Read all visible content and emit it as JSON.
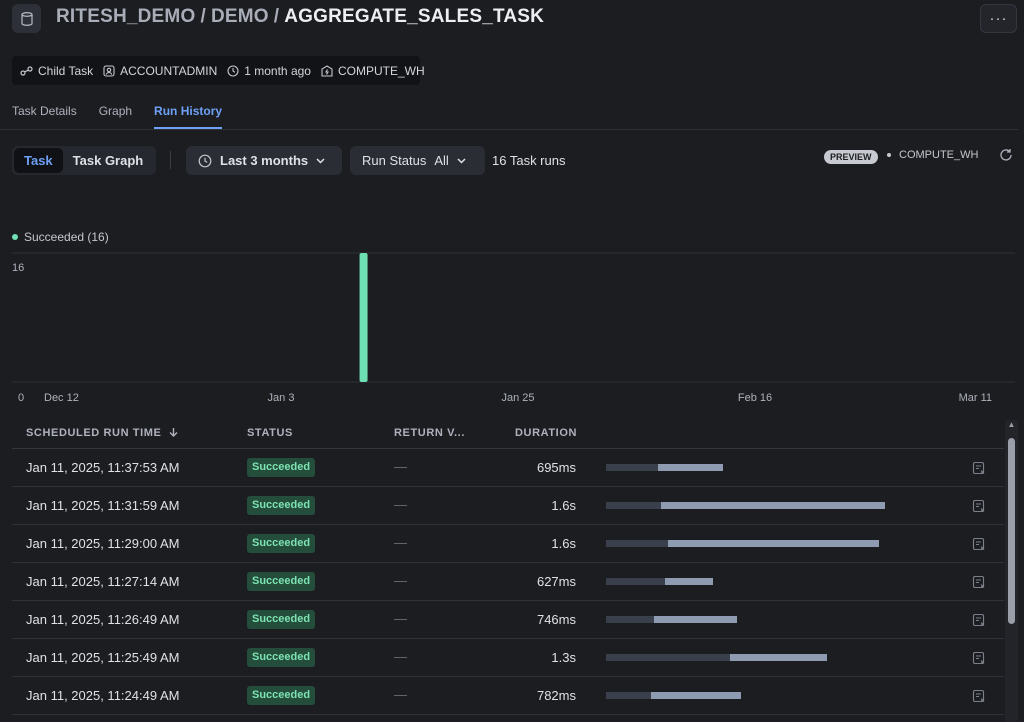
{
  "header": {
    "crumb1": "RITESH_DEMO",
    "crumb2": "DEMO",
    "separator": "/",
    "title": "AGGREGATE_SALES_TASK",
    "more_label": "···"
  },
  "meta": {
    "task_type": "Child Task",
    "role": "ACCOUNTADMIN",
    "age": "1 month ago",
    "warehouse": "COMPUTE_WH"
  },
  "tabs": [
    {
      "label": "Task Details",
      "active": false
    },
    {
      "label": "Graph",
      "active": false
    },
    {
      "label": "Run History",
      "active": true
    }
  ],
  "toolbar": {
    "view_task": "Task",
    "view_graph": "Task Graph",
    "range": "Last 3 months",
    "status_label": "Run Status",
    "status_value": "All",
    "runs_count": "16 Task runs",
    "preview": "PREVIEW",
    "warehouse": "COMPUTE_WH"
  },
  "chart_data": {
    "type": "bar",
    "legend": [
      {
        "name": "Succeeded (16)",
        "color": "#6fe0b4"
      }
    ],
    "y_ticks": [
      "16",
      "0"
    ],
    "ylim": [
      0,
      16
    ],
    "x_ticks": [
      "Dec 12",
      "Jan 3",
      "Jan 25",
      "Feb 16",
      "Mar 11"
    ],
    "series": [
      {
        "name": "Succeeded",
        "color": "#6fe0b4",
        "points": [
          {
            "x": "Jan 11",
            "y": 16
          }
        ]
      }
    ]
  },
  "table": {
    "columns": [
      "SCHEDULED RUN TIME",
      "STATUS",
      "RETURN V...",
      "DURATION"
    ],
    "sort_icon": "arrow-down-icon",
    "rows": [
      {
        "time": "Jan 11, 2025, 11:37:53 AM",
        "status": "Succeeded",
        "return": "—",
        "duration": "695ms",
        "queued": 0.15,
        "exec": 0.34
      },
      {
        "time": "Jan 11, 2025, 11:31:59 AM",
        "status": "Succeeded",
        "return": "—",
        "duration": "1.6s",
        "queued": 0.16,
        "exec": 0.81
      },
      {
        "time": "Jan 11, 2025, 11:29:00 AM",
        "status": "Succeeded",
        "return": "—",
        "duration": "1.6s",
        "queued": 0.18,
        "exec": 0.79
      },
      {
        "time": "Jan 11, 2025, 11:27:14 AM",
        "status": "Succeeded",
        "return": "—",
        "duration": "627ms",
        "queued": 0.17,
        "exec": 0.31
      },
      {
        "time": "Jan 11, 2025, 11:26:49 AM",
        "status": "Succeeded",
        "return": "—",
        "duration": "746ms",
        "queued": 0.14,
        "exec": 0.38
      },
      {
        "time": "Jan 11, 2025, 11:25:49 AM",
        "status": "Succeeded",
        "return": "—",
        "duration": "1.3s",
        "queued": 0.36,
        "exec": 0.64
      },
      {
        "time": "Jan 11, 2025, 11:24:49 AM",
        "status": "Succeeded",
        "return": "—",
        "duration": "782ms",
        "queued": 0.13,
        "exec": 0.39
      }
    ]
  },
  "colors": {
    "accent": "#6ea0f6",
    "success": "#6fe0b4",
    "badge_bg": "#244d3b"
  }
}
